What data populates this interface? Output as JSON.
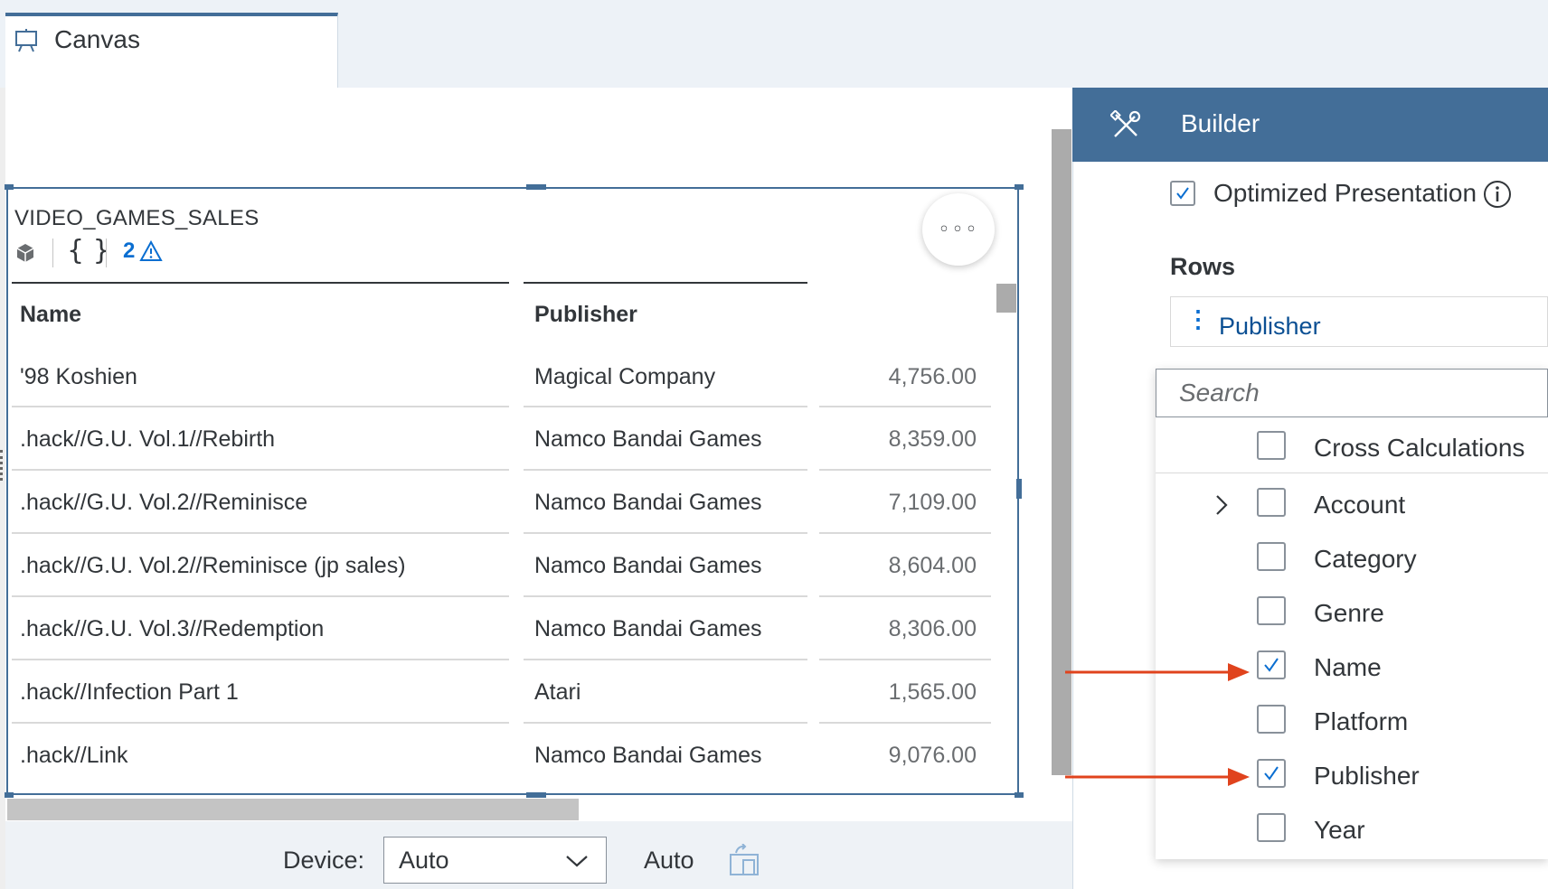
{
  "tab": {
    "label": "Canvas",
    "icon": "presentation-icon"
  },
  "widget": {
    "title": "VIDEO_GAMES_SALES",
    "warning_count": "2",
    "more_label": "◦◦◦"
  },
  "table": {
    "headers": [
      "Name",
      "Publisher"
    ],
    "rows": [
      {
        "name": "'98 Koshien",
        "publisher": "Magical Company",
        "value": "4,756.00"
      },
      {
        "name": ".hack//G.U. Vol.1//Rebirth",
        "publisher": "Namco Bandai Games",
        "value": "8,359.00"
      },
      {
        "name": ".hack//G.U. Vol.2//Reminisce",
        "publisher": "Namco Bandai Games",
        "value": "7,109.00"
      },
      {
        "name": ".hack//G.U. Vol.2//Reminisce (jp sales)",
        "publisher": "Namco Bandai Games",
        "value": "8,604.00"
      },
      {
        "name": ".hack//G.U. Vol.3//Redemption",
        "publisher": "Namco Bandai Games",
        "value": "8,306.00"
      },
      {
        "name": ".hack//Infection Part 1",
        "publisher": "Atari",
        "value": "1,565.00"
      },
      {
        "name": ".hack//Link",
        "publisher": "Namco Bandai Games",
        "value": "9,076.00"
      }
    ]
  },
  "footer": {
    "device_label": "Device:",
    "device_value": "Auto",
    "orientation_label": "Auto"
  },
  "builder": {
    "title": "Builder",
    "optimized_label": "Optimized Presentation",
    "optimized_checked": true,
    "rows_title": "Rows",
    "rows_token": "Publisher",
    "search_placeholder": "Search",
    "dimensions": [
      {
        "label": "Cross Calculations",
        "checked": false
      },
      {
        "label": "Account",
        "checked": false
      },
      {
        "label": "Category",
        "checked": false
      },
      {
        "label": "Genre",
        "checked": false
      },
      {
        "label": "Name",
        "checked": true
      },
      {
        "label": "Platform",
        "checked": false
      },
      {
        "label": "Publisher",
        "checked": true
      },
      {
        "label": "Year",
        "checked": false
      }
    ]
  },
  "colors": {
    "accent": "#436e98",
    "link": "#0a6ed1",
    "annotation_arrow": "#e0431d"
  }
}
